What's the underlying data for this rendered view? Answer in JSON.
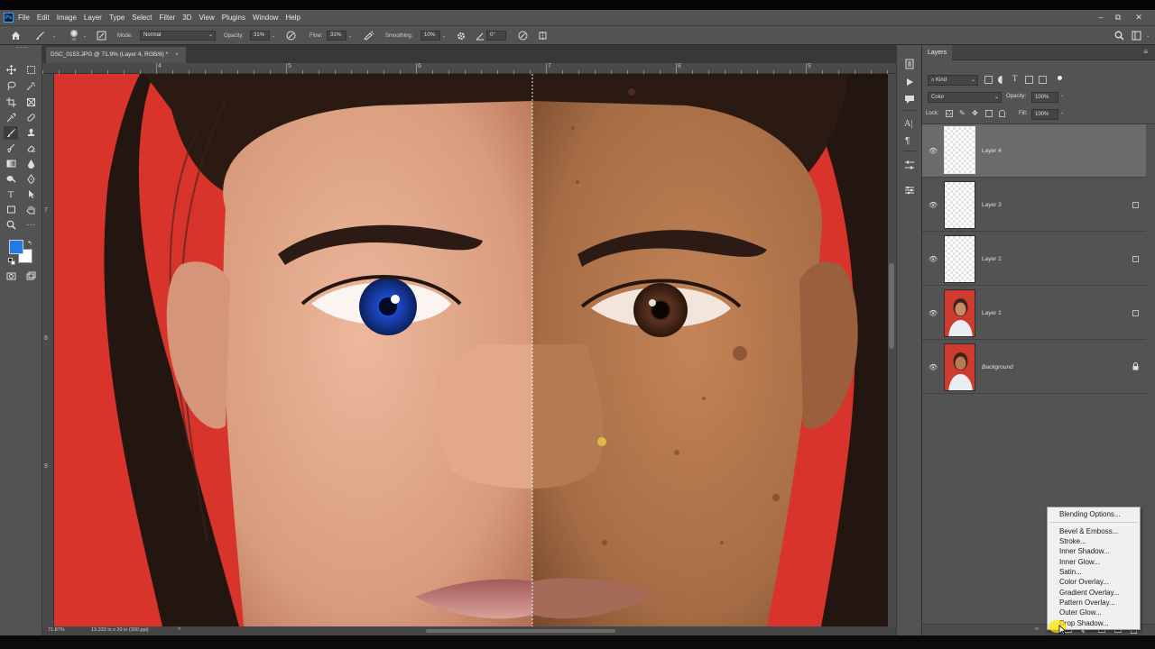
{
  "app": {
    "logo": "Ps"
  },
  "menubar": {
    "items": [
      "File",
      "Edit",
      "Image",
      "Layer",
      "Type",
      "Select",
      "Filter",
      "3D",
      "View",
      "Plugins",
      "Window",
      "Help"
    ]
  },
  "window_controls": {
    "minimize": "–",
    "restore": "⧉",
    "close": "✕"
  },
  "options_bar": {
    "mode_label": "Mode:",
    "mode_value": "Normal",
    "opacity_label": "Opacity:",
    "opacity_value": "31%",
    "flow_label": "Flow:",
    "flow_value": "31%",
    "smoothing_label": "Smoothing:",
    "smoothing_value": "10%",
    "angle_value": "0°",
    "brush_size": "41"
  },
  "document": {
    "tab_title": "DSC_0153.JPG @ 71.9% (Layer 4, RGB/8) *",
    "close": "×"
  },
  "rulers": {
    "top": [
      "4",
      "5",
      "6",
      "7",
      "8",
      "9"
    ],
    "left": [
      "7",
      "8",
      "9"
    ]
  },
  "statusbar": {
    "zoom": "71.87%",
    "doc_info": "13.333 in x 20 in (300 ppi)",
    "arrow": ">"
  },
  "colors": {
    "foreground": "#1f7ce6",
    "background": "#ffffff",
    "canvas_bg": "#d8342c",
    "ui_panel": "#535353",
    "menu_bg": "#f0f0f0"
  },
  "layers_panel": {
    "tab": "Layers",
    "filter_kind": "Kind",
    "blend_mode": "Color",
    "opacity_label": "Opacity:",
    "opacity_value": "100%",
    "lock_label": "Lock:",
    "fill_label": "Fill:",
    "fill_value": "100%",
    "layers": [
      {
        "name": "Layer 4",
        "thumb": "transparent",
        "selected": true
      },
      {
        "name": "Layer 3",
        "thumb": "transparent",
        "selected": false
      },
      {
        "name": "Layer 2",
        "thumb": "transparent",
        "selected": false
      },
      {
        "name": "Layer 1",
        "thumb": "photo",
        "selected": false
      },
      {
        "name": "Background",
        "thumb": "photo",
        "selected": false,
        "italic": true,
        "locked": true
      }
    ]
  },
  "context_menu": {
    "items": [
      "Blending Options...",
      "Bevel & Emboss...",
      "Stroke...",
      "Inner Shadow...",
      "Inner Glow...",
      "Satin...",
      "Color Overlay...",
      "Gradient Overlay...",
      "Pattern Overlay...",
      "Outer Glow...",
      "Drop Shadow..."
    ]
  },
  "icons": {
    "home": "home-icon",
    "brush": "brush-icon",
    "search": "search-icon",
    "workspace": "workspace-icon",
    "share": "share-icon"
  }
}
